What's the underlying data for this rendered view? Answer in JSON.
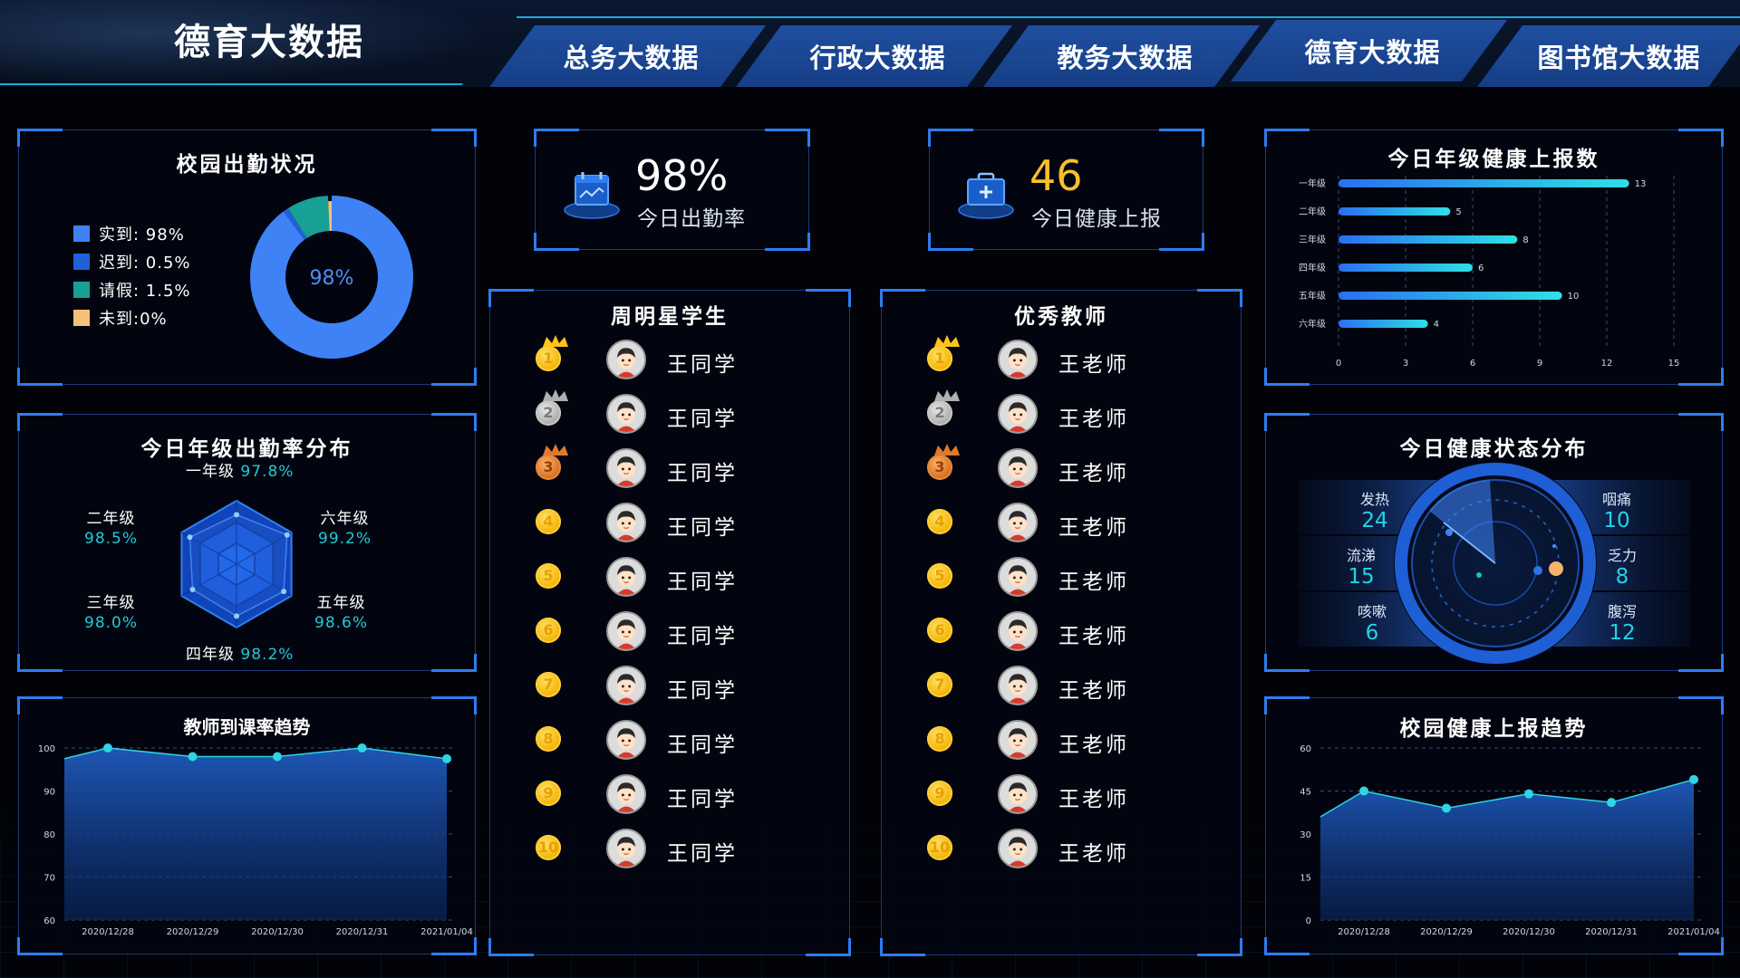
{
  "header": {
    "title": "德育大数据",
    "tabs": [
      {
        "label": "总务大数据"
      },
      {
        "label": "行政大数据"
      },
      {
        "label": "教务大数据"
      },
      {
        "label": "德育大数据"
      },
      {
        "label": "图书馆大数据"
      }
    ]
  },
  "attendance": {
    "title": "校园出勤状况",
    "center_label": "98%",
    "legend": [
      {
        "label": "实到: 98%",
        "color": "#3f82f5"
      },
      {
        "label": "迟到: 0.5%",
        "color": "#1f61d9"
      },
      {
        "label": "请假: 1.5%",
        "color": "#18a096"
      },
      {
        "label": "未到:0%",
        "color": "#f7c07a"
      }
    ],
    "chart_data": {
      "type": "pie",
      "categories": [
        "实到",
        "迟到",
        "请假",
        "未到"
      ],
      "values": [
        98,
        0.5,
        1.5,
        0
      ],
      "colors": [
        "#3f82f5",
        "#1f61d9",
        "#18a096",
        "#f7c07a"
      ]
    }
  },
  "stats": {
    "attendance_rate": {
      "value": "98%",
      "label": "今日出勤率",
      "color": "#ffffff"
    },
    "health_reports": {
      "value": "46",
      "label": "今日健康上报",
      "color": "#f7c02a"
    }
  },
  "grade_health": {
    "title": "今日年级健康上报数",
    "chart_data": {
      "type": "bar",
      "orientation": "horizontal",
      "categories": [
        "一年级",
        "二年级",
        "三年级",
        "四年级",
        "五年级",
        "六年级"
      ],
      "values": [
        13,
        5,
        8,
        6,
        10,
        4
      ],
      "xlim": [
        0,
        15
      ],
      "xticks": [
        "0",
        "3",
        "6",
        "9",
        "12",
        "15"
      ]
    }
  },
  "grade_attendance": {
    "title": "今日年级出勤率分布",
    "chart_data": {
      "type": "radar",
      "categories": [
        "一年级",
        "六年级",
        "五年级",
        "四年级",
        "三年级",
        "二年级"
      ],
      "values": [
        97.8,
        99.2,
        98.6,
        98.2,
        98.0,
        98.5
      ]
    },
    "labels": [
      {
        "name": "一年级",
        "value": "97.8%"
      },
      {
        "name": "六年级",
        "value": "99.2%"
      },
      {
        "name": "五年级",
        "value": "98.6%"
      },
      {
        "name": "四年级",
        "value": "98.2%"
      },
      {
        "name": "三年级",
        "value": "98.0%"
      },
      {
        "name": "二年级",
        "value": "98.5%"
      }
    ]
  },
  "teacher_trend": {
    "title": "教师到课率趋势",
    "chart_data": {
      "type": "area",
      "x": [
        "2020/12/28",
        "2020/12/29",
        "2020/12/30",
        "2020/12/31",
        "2021/01/04"
      ],
      "values": [
        100,
        98,
        98,
        100,
        97.5
      ],
      "start_value": 97.5,
      "ylim": [
        60,
        100
      ],
      "yticks": [
        "60",
        "70",
        "80",
        "90",
        "100"
      ]
    }
  },
  "star_students": {
    "title": "周明星学生",
    "items": [
      {
        "rank": "1",
        "name": "王同学"
      },
      {
        "rank": "2",
        "name": "王同学"
      },
      {
        "rank": "3",
        "name": "王同学"
      },
      {
        "rank": "4",
        "name": "王同学"
      },
      {
        "rank": "5",
        "name": "王同学"
      },
      {
        "rank": "6",
        "name": "王同学"
      },
      {
        "rank": "7",
        "name": "王同学"
      },
      {
        "rank": "8",
        "name": "王同学"
      },
      {
        "rank": "9",
        "name": "王同学"
      },
      {
        "rank": "10",
        "name": "王同学"
      }
    ]
  },
  "excellent_teachers": {
    "title": "优秀教师",
    "items": [
      {
        "rank": "1",
        "name": "王老师"
      },
      {
        "rank": "2",
        "name": "王老师"
      },
      {
        "rank": "3",
        "name": "王老师"
      },
      {
        "rank": "4",
        "name": "王老师"
      },
      {
        "rank": "5",
        "name": "王老师"
      },
      {
        "rank": "6",
        "name": "王老师"
      },
      {
        "rank": "7",
        "name": "王老师"
      },
      {
        "rank": "8",
        "name": "王老师"
      },
      {
        "rank": "9",
        "name": "王老师"
      },
      {
        "rank": "10",
        "name": "王老师"
      }
    ]
  },
  "health_status": {
    "title": "今日健康状态分布",
    "items": [
      {
        "name": "发热",
        "value": "24"
      },
      {
        "name": "流涕",
        "value": "15"
      },
      {
        "name": "咳嗽",
        "value": "6"
      },
      {
        "name": "咽痛",
        "value": "10"
      },
      {
        "name": "乏力",
        "value": "8"
      },
      {
        "name": "腹泻",
        "value": "12"
      }
    ]
  },
  "health_trend": {
    "title": "校园健康上报趋势",
    "chart_data": {
      "type": "area",
      "x": [
        "2020/12/28",
        "2020/12/29",
        "2020/12/30",
        "2020/12/31",
        "2021/01/04"
      ],
      "values": [
        45,
        39,
        44,
        41,
        49
      ],
      "start_value": 36,
      "ylim": [
        0,
        60
      ],
      "yticks": [
        "0",
        "15",
        "30",
        "45",
        "60"
      ]
    }
  }
}
